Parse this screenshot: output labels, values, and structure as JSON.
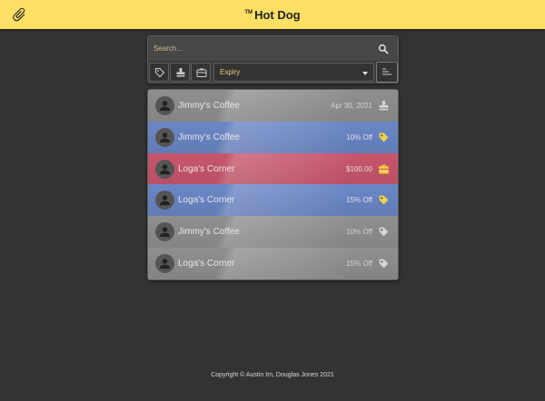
{
  "header": {
    "tm": "TM",
    "title": "Hot Dog"
  },
  "search": {
    "placeholder": "Search..."
  },
  "filter": {
    "sort_value": "Expiry"
  },
  "rows": [
    {
      "merchant": "Jimmy's Coffee",
      "value": "Apr 30, 2021",
      "type_icon": "stamp-icon",
      "color": "#8f8f8f"
    },
    {
      "merchant": "Jimmy's Coffee",
      "value": "10% Off",
      "type_icon": "tag-icon",
      "color": "#6a86c6"
    },
    {
      "merchant": "Loga's Corner",
      "value": "$100.00",
      "type_icon": "gift-card-icon",
      "color": "#c8566c"
    },
    {
      "merchant": "Loga's Corner",
      "value": "15% Off",
      "type_icon": "tag-icon",
      "color": "#6a86c6"
    },
    {
      "merchant": "Jimmy's Coffee",
      "value": "10% Off",
      "type_icon": "tag-icon",
      "color": "#8f8f8f"
    },
    {
      "merchant": "Loga's Corner",
      "value": "15% Off",
      "type_icon": "tag-icon",
      "color": "#8f8f8f"
    }
  ],
  "footer": {
    "copyright": "Copyright © Austin Im, Douglas Jones 2021"
  },
  "colors": {
    "topbar": "#ffdf66",
    "background": "#333333",
    "accent_gold": "#e4cf75"
  }
}
